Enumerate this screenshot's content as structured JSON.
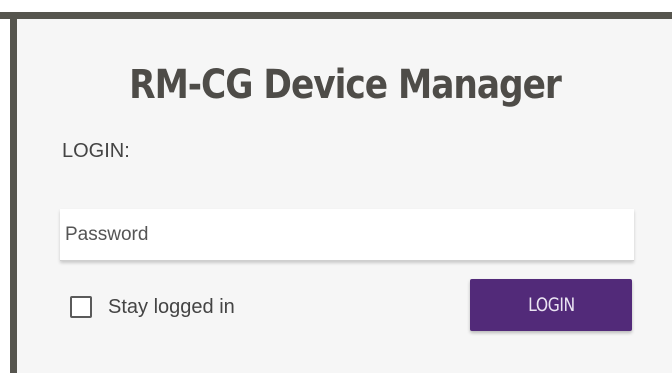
{
  "app": {
    "title": "RM-CG Device Manager"
  },
  "login": {
    "heading": "LOGIN:",
    "password_placeholder": "Password",
    "password_value": "",
    "stay_logged_in_label": "Stay logged in",
    "stay_logged_in_checked": false,
    "button_label": "LOGIN"
  },
  "colors": {
    "border": "#56554e",
    "panel_background": "#f6f6f6",
    "title_text": "#4e4c48",
    "button_background": "#522a79",
    "button_text": "#eae4f2"
  },
  "icons": {
    "checkbox": "checkbox-unchecked-icon"
  }
}
